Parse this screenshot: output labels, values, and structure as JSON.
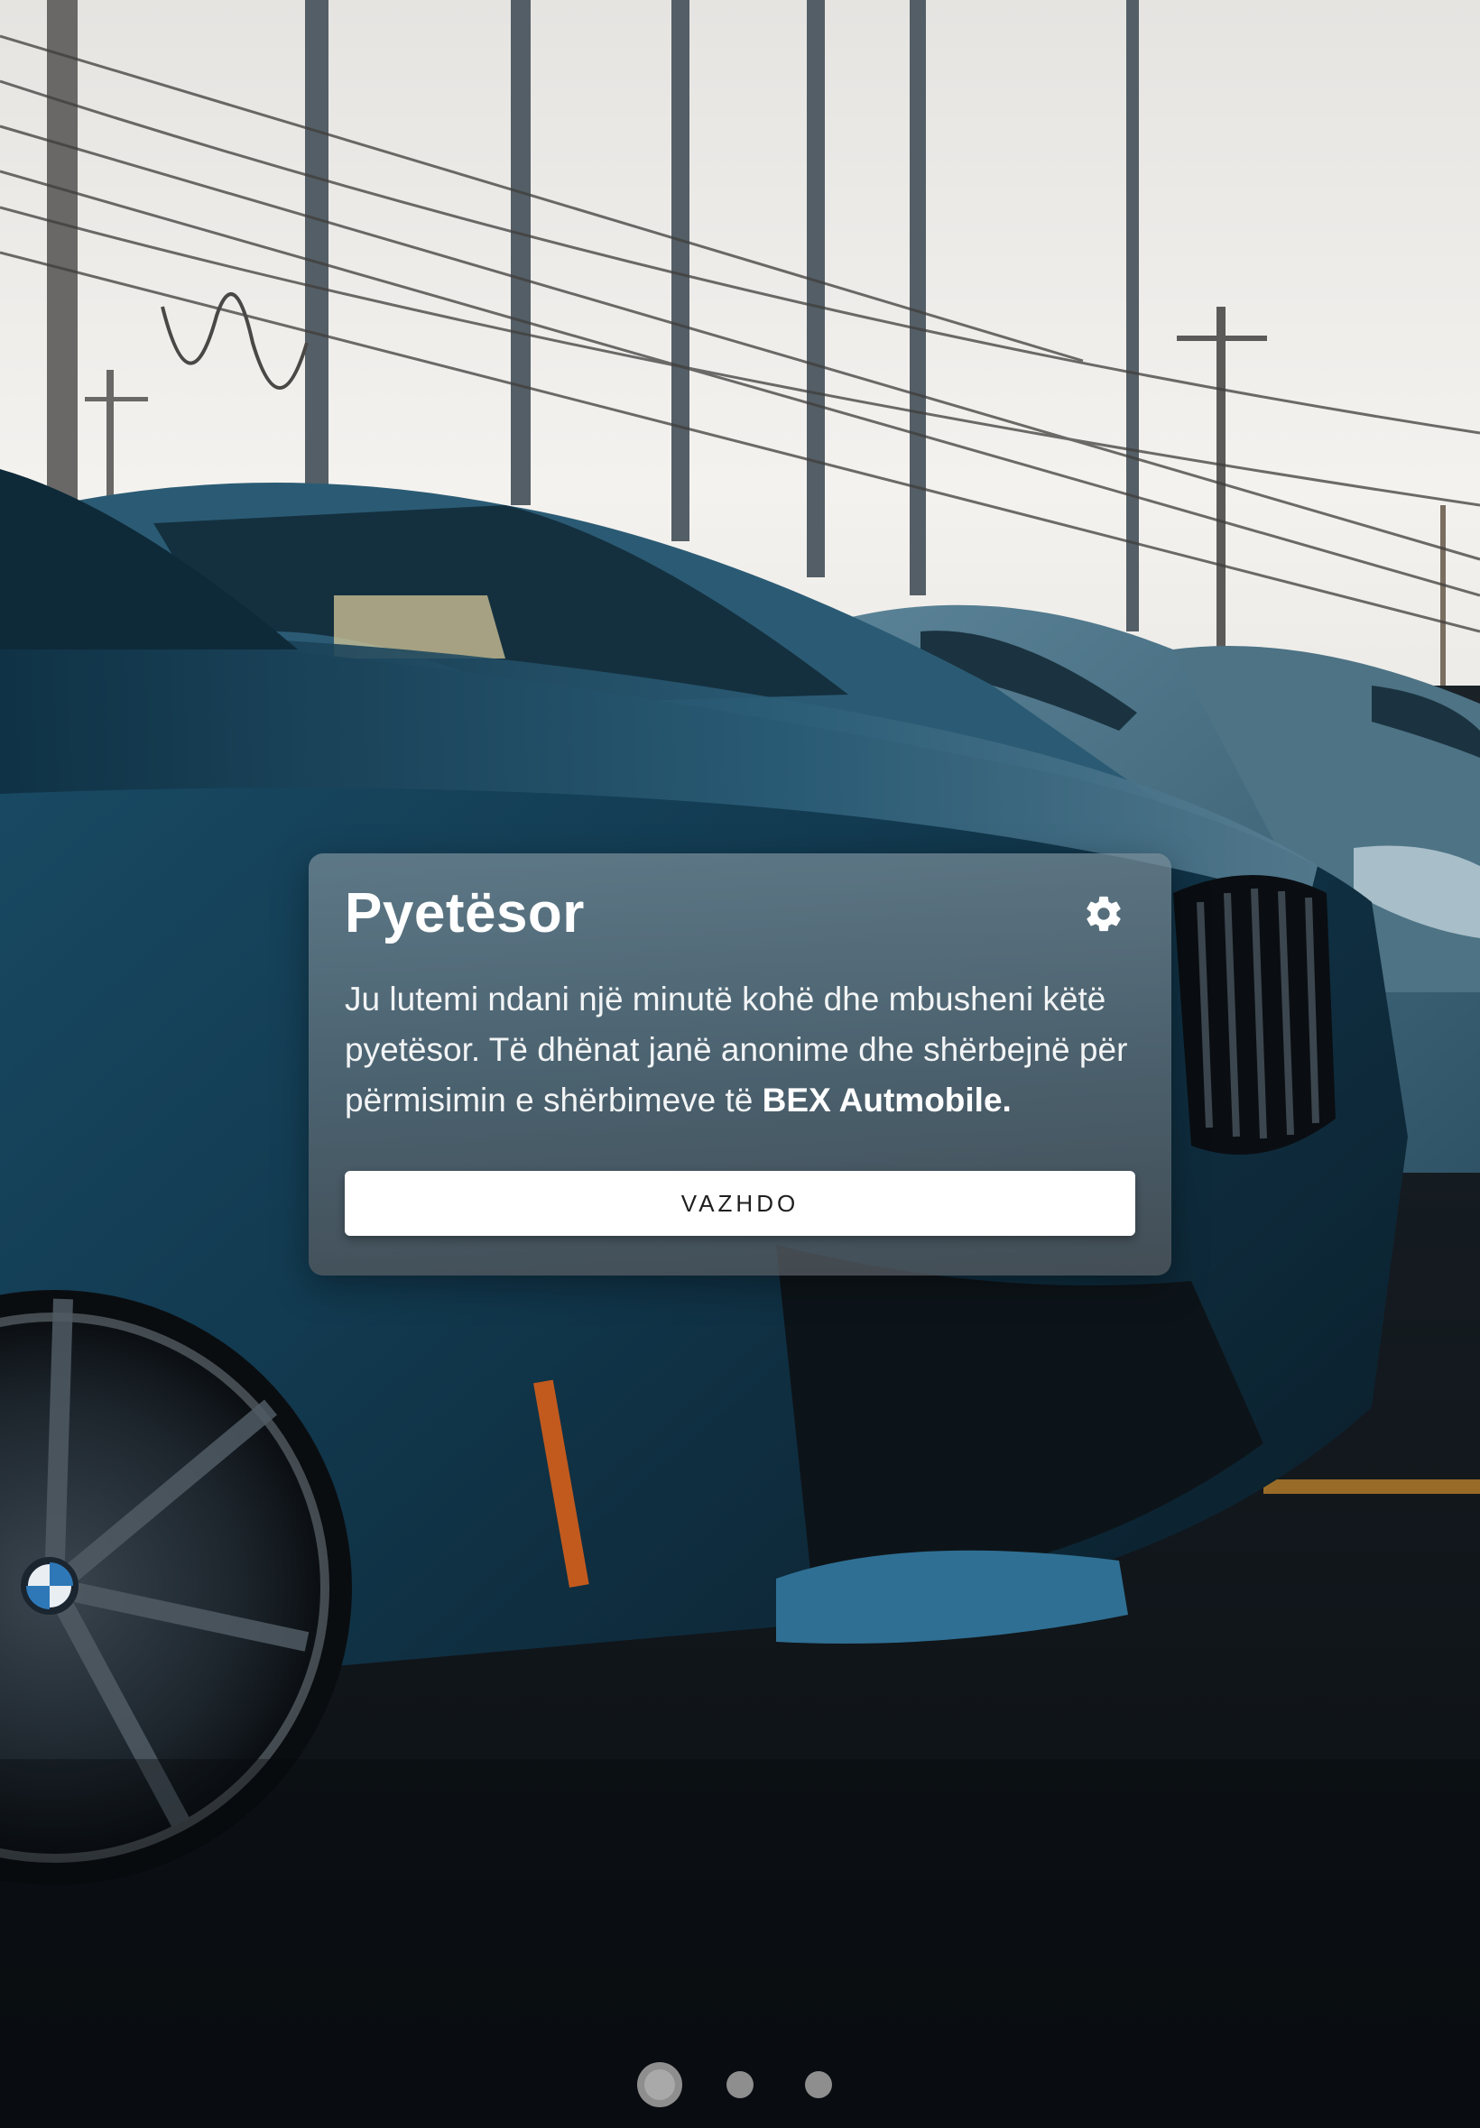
{
  "background": {
    "subject": "car-parking-lot-photo",
    "sky_color": "#eaeae8",
    "car_color": "#12364a",
    "ground_color": "#0e1318"
  },
  "card": {
    "title": "Pyetësor",
    "settings_icon": "gear-icon",
    "body_text": "Ju lutemi ndani një minutë kohë dhe mbusheni këtë pyetësor. Të dhënat janë anonime dhe shërbejnë për përmisimin e shërbimeve të ",
    "brand_name": "BEX Autmobile.",
    "continue_label": "VAZHDO"
  },
  "pagination": {
    "page_count": 3,
    "active_index": 0
  }
}
